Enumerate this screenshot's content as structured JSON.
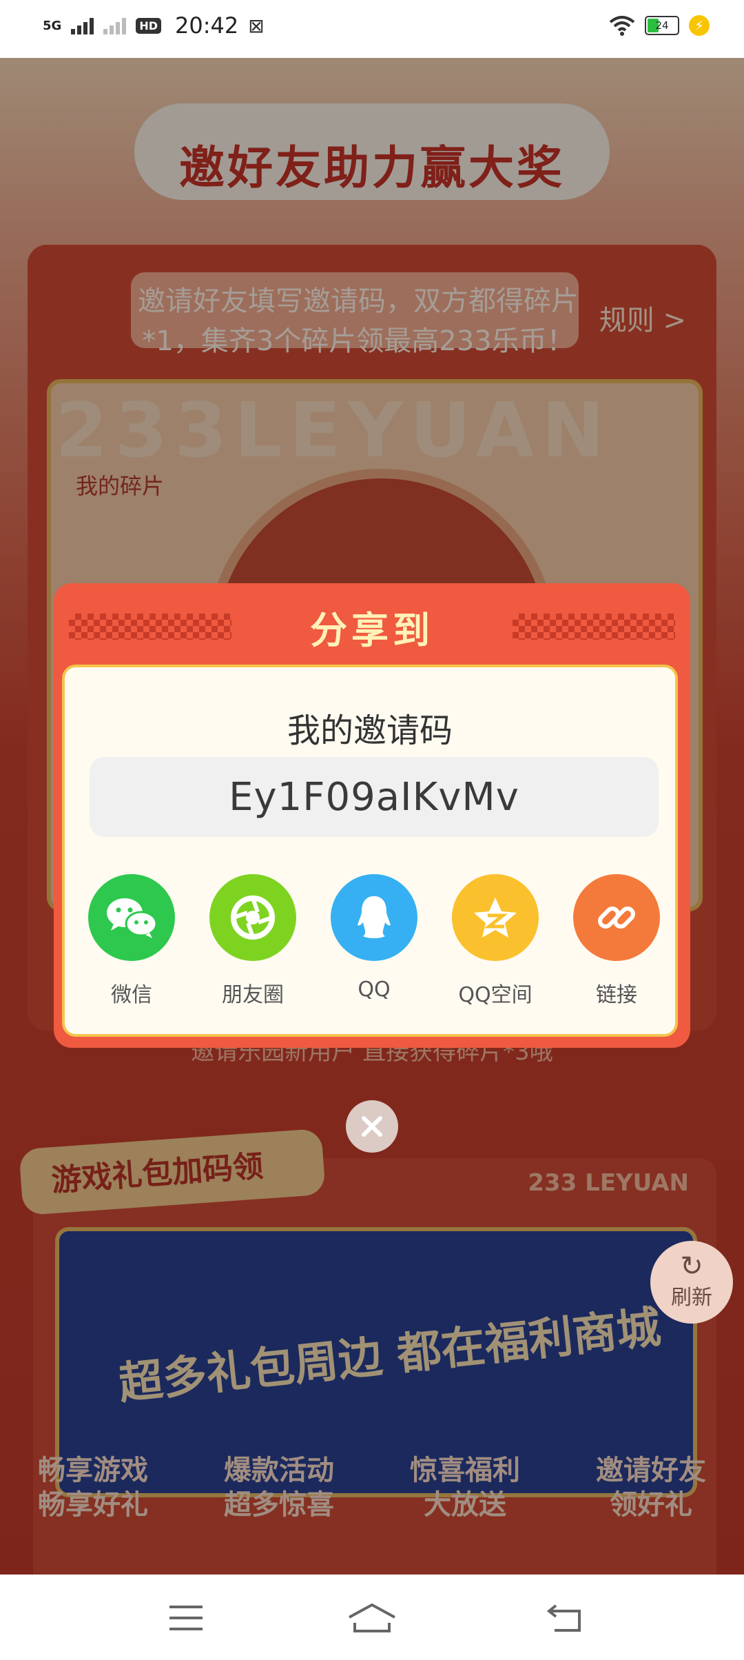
{
  "status_bar": {
    "network": "5G",
    "hd_badge": "HD",
    "time": "20:42",
    "battery_level": "24"
  },
  "background": {
    "title": "邀好友助力赢大奖",
    "invite_desc": "邀请好友填写邀请码，双方都得碎片*1，集齐3个碎片领最高233乐币！",
    "rules_link": "规则 >",
    "bg_watermark": "233LEYUAN",
    "fragments_label": "我的碎片",
    "footnote": "邀请乐园新用户 直接获得碎片*3哦",
    "gift_section_title": "游戏礼包加码领",
    "leyuan_text": "233 LEYUAN",
    "banner_title": "超多礼包周边 都在福利商城",
    "refresh_label": "刷新",
    "features": [
      {
        "line1": "畅享游戏",
        "line2": "畅享好礼"
      },
      {
        "line1": "爆款活动",
        "line2": "超多惊喜"
      },
      {
        "line1": "惊喜福利",
        "line2": "大放送"
      },
      {
        "line1": "邀请好友",
        "line2": "领好礼"
      }
    ]
  },
  "share_dialog": {
    "title": "分享到",
    "code_label": "我的邀请码",
    "invite_code": "Ey1F09aIKvMv",
    "targets": [
      {
        "label": "微信",
        "icon": "wechat-icon",
        "color": "#2dc84d"
      },
      {
        "label": "朋友圈",
        "icon": "moments-icon",
        "color": "#7ed321"
      },
      {
        "label": "QQ",
        "icon": "qq-icon",
        "color": "#36b0f2"
      },
      {
        "label": "QQ空间",
        "icon": "qzone-icon",
        "color": "#fbc02d"
      },
      {
        "label": "链接",
        "icon": "link-icon",
        "color": "#f47a3c"
      }
    ]
  },
  "colors": {
    "dialog_red": "#ef5a40",
    "panel_border": "#f4c44c",
    "title_yellow": "#fff2b8"
  }
}
